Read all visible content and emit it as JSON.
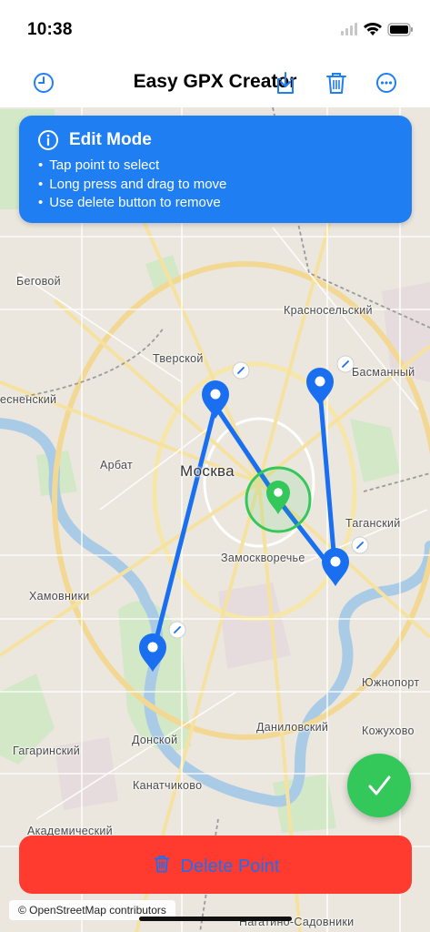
{
  "status": {
    "time": "10:38"
  },
  "nav": {
    "title": "Easy GPX Creator"
  },
  "banner": {
    "title": "Edit Mode",
    "items": [
      "Tap point to select",
      "Long press and drag to move",
      "Use delete button to remove"
    ]
  },
  "map": {
    "labels": [
      "Беговой",
      "Красносельский",
      "Тверской",
      "Басманный",
      "есненский",
      "Арбат",
      "Москва",
      "Таганский",
      "Замоскворечье",
      "Хамовники",
      "Южнопорт",
      "Даниловский",
      "Кожухово",
      "Донской",
      "Гагаринский",
      "Канатчиково",
      "Академический",
      "Нагатино-Садовники"
    ],
    "attribution": "© OpenStreetMap contributors"
  },
  "delete": {
    "label": "Delete Point"
  },
  "colors": {
    "accent": "#1f7ff2",
    "route": "#1a6ff0",
    "selected": "#34c759",
    "danger": "#ff3b30"
  }
}
